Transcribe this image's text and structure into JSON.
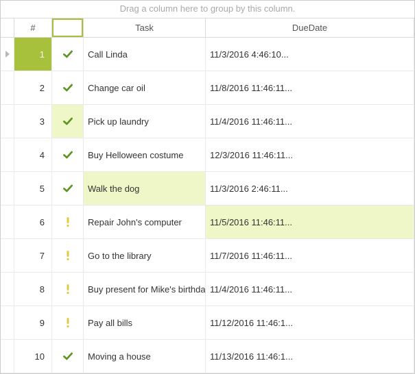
{
  "groupPanelText": "Drag a column here to group by this column.",
  "columns": {
    "indicator": "",
    "number": "#",
    "status": "",
    "task": "Task",
    "dueDate": "DueDate"
  },
  "selectedRowIndex": 0,
  "rows": [
    {
      "num": "1",
      "status": "check",
      "task": "Call Linda",
      "due": "11/3/2016 4:46:10...",
      "indicator": true
    },
    {
      "num": "2",
      "status": "check",
      "task": "Change car oil",
      "due": "11/8/2016 11:46:11..."
    },
    {
      "num": "3",
      "status": "check",
      "task": "Pick up laundry",
      "due": "11/4/2016 11:46:11...",
      "hl": [
        "status"
      ]
    },
    {
      "num": "4",
      "status": "check",
      "task": "Buy Helloween costume",
      "due": "12/3/2016 11:46:11..."
    },
    {
      "num": "5",
      "status": "check",
      "task": "Walk the dog",
      "due": "11/3/2016 2:46:11...",
      "hl": [
        "task"
      ]
    },
    {
      "num": "6",
      "status": "exclaim",
      "task": "Repair John's computer",
      "due": "11/5/2016 11:46:11...",
      "hl": [
        "due"
      ]
    },
    {
      "num": "7",
      "status": "exclaim",
      "task": "Go to the library",
      "due": "11/7/2016 11:46:11..."
    },
    {
      "num": "8",
      "status": "exclaim",
      "task": "Buy present for Mike's birthday",
      "due": "11/4/2016 11:46:11..."
    },
    {
      "num": "9",
      "status": "exclaim",
      "task": "Pay all bills",
      "due": "11/12/2016 11:46:1..."
    },
    {
      "num": "10",
      "status": "check",
      "task": "Moving a house",
      "due": "11/13/2016 11:46:1..."
    }
  ]
}
